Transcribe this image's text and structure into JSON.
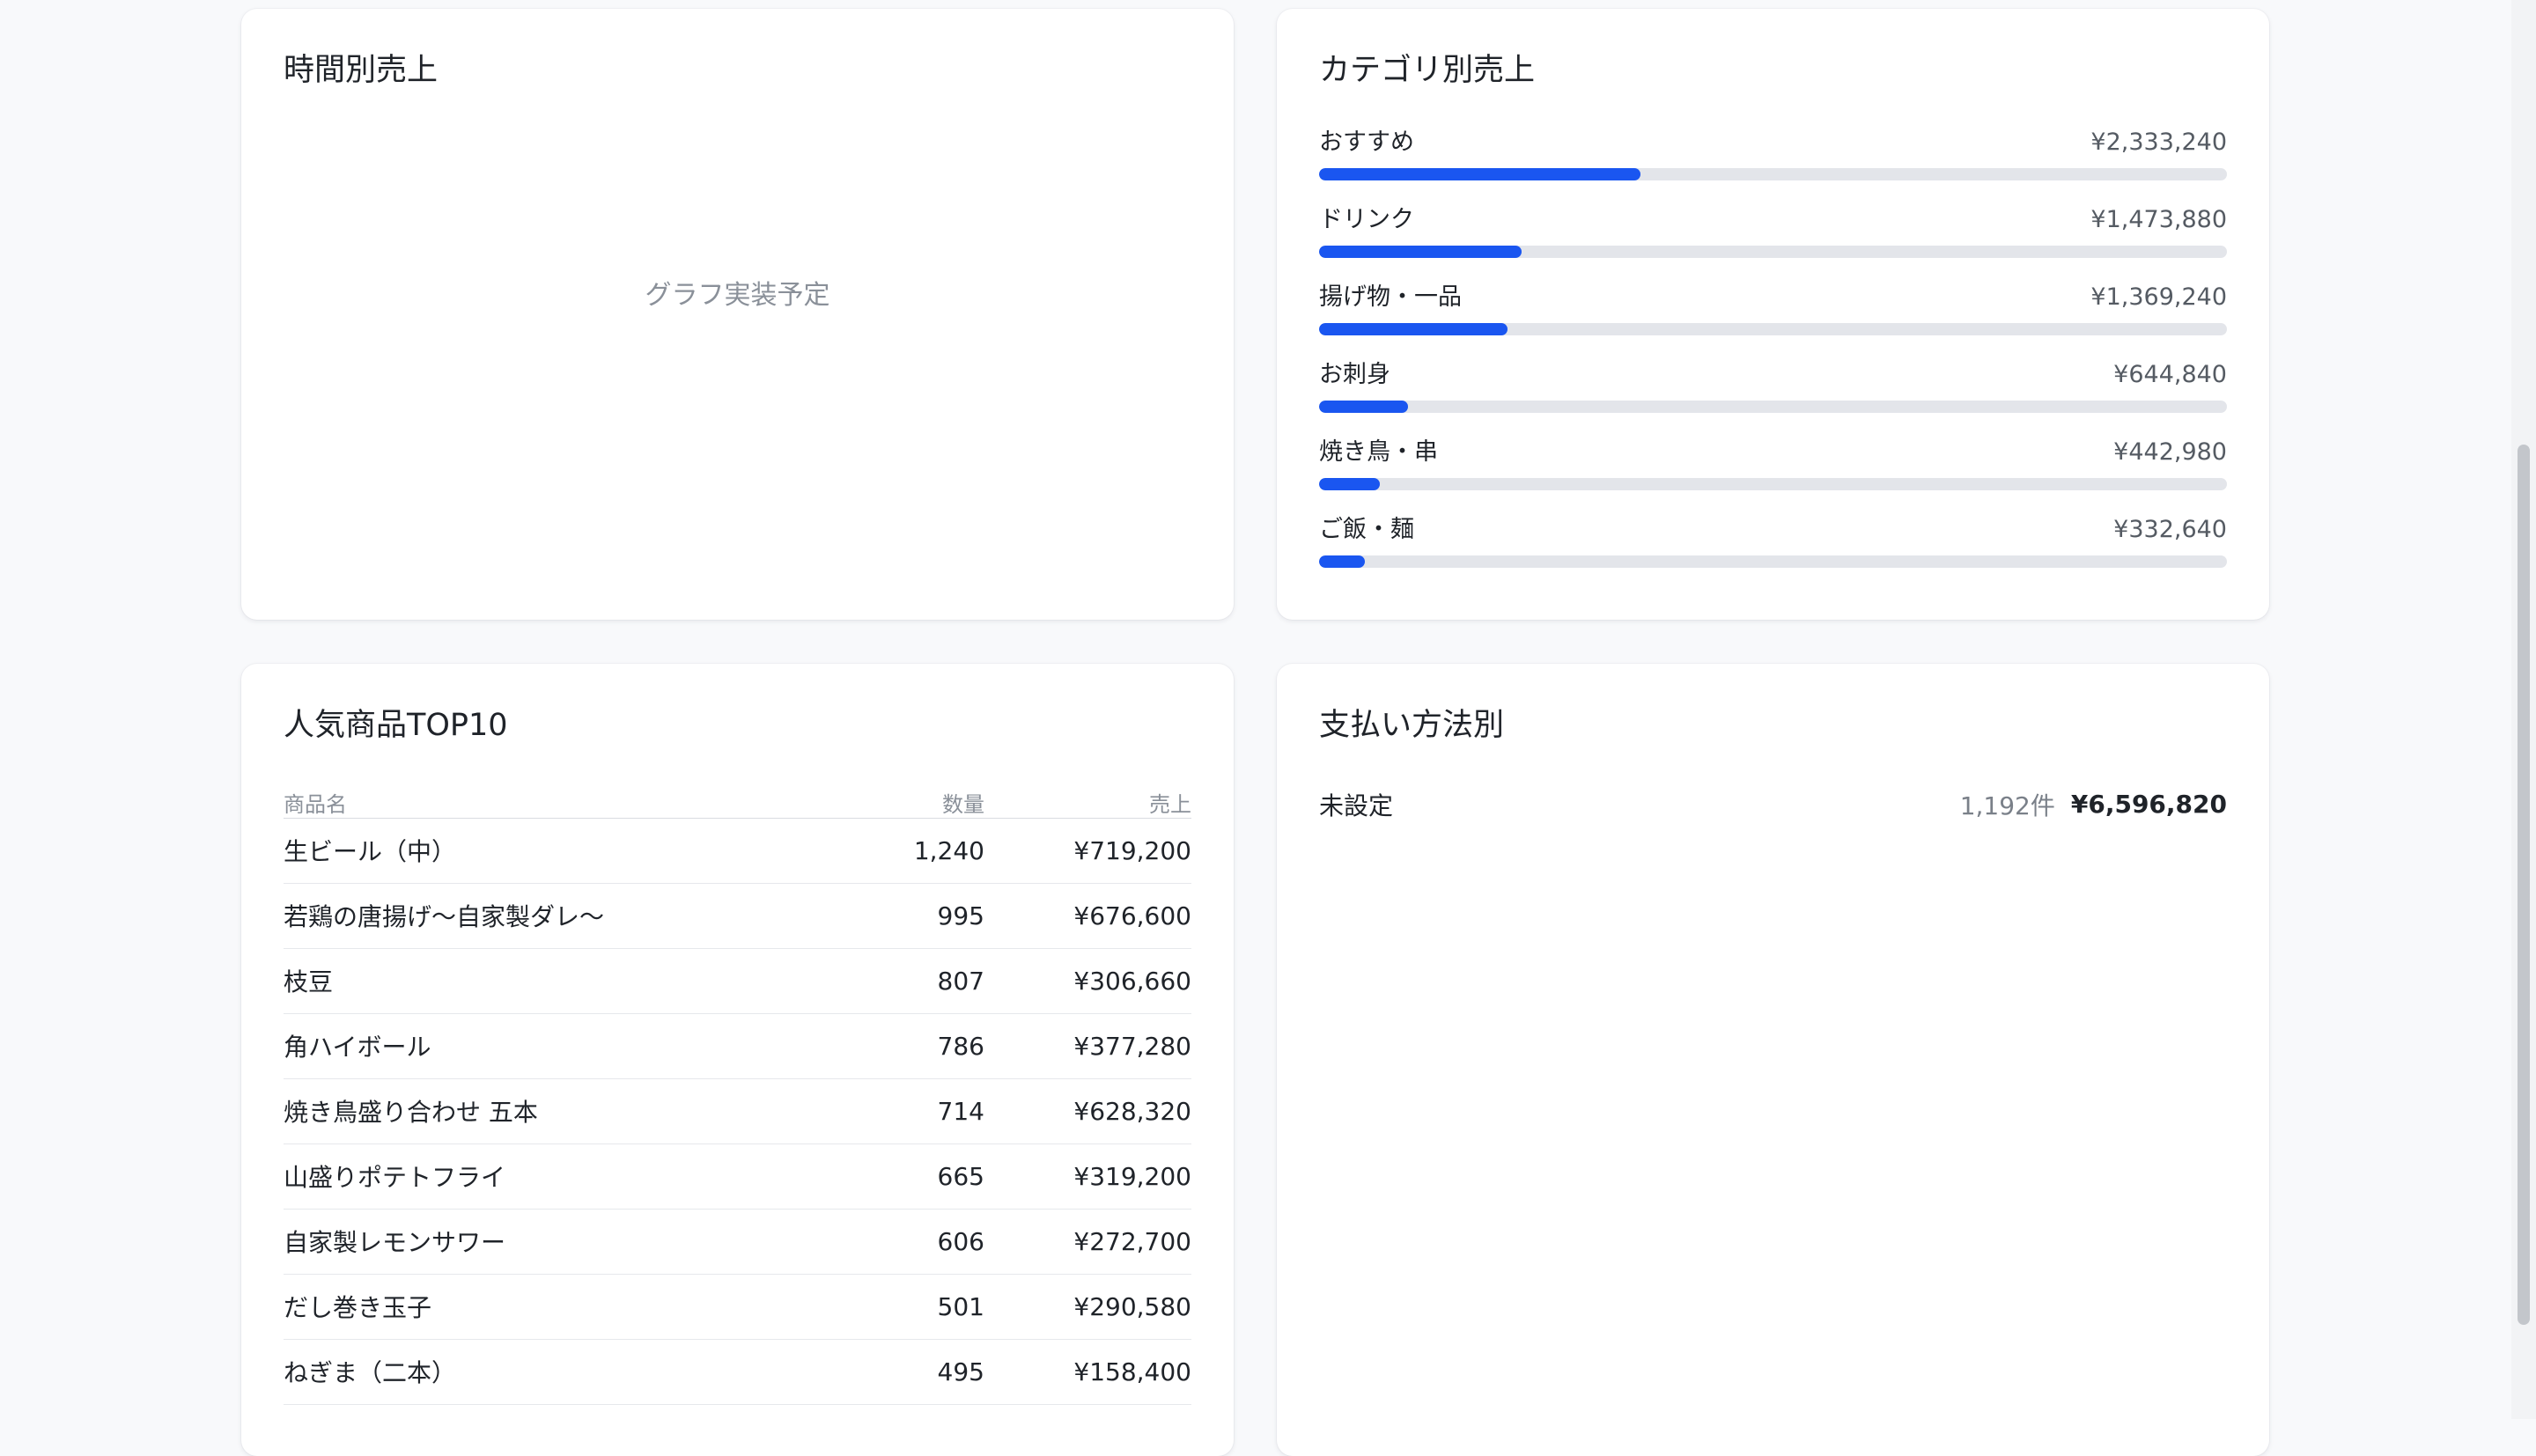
{
  "hourly": {
    "title": "時間別売上",
    "placeholder": "グラフ実装予定"
  },
  "category": {
    "title": "カテゴリ別売上",
    "accent_color": "#1a56f0",
    "items": [
      {
        "name": "おすすめ",
        "amount": "¥2,333,240",
        "share": 0.354
      },
      {
        "name": "ドリンク",
        "amount": "¥1,473,880",
        "share": 0.223
      },
      {
        "name": "揚げ物・一品",
        "amount": "¥1,369,240",
        "share": 0.208
      },
      {
        "name": "お刺身",
        "amount": "¥644,840",
        "share": 0.098
      },
      {
        "name": "焼き鳥・串",
        "amount": "¥442,980",
        "share": 0.067
      },
      {
        "name": "ご飯・麺",
        "amount": "¥332,640",
        "share": 0.05
      }
    ]
  },
  "top10": {
    "title": "人気商品TOP10",
    "headers": {
      "name": "商品名",
      "qty": "数量",
      "sales": "売上"
    },
    "rows": [
      {
        "name": "生ビール（中）",
        "qty": "1,240",
        "sales": "¥719,200"
      },
      {
        "name": "若鶏の唐揚げ〜自家製ダレ〜",
        "qty": "995",
        "sales": "¥676,600"
      },
      {
        "name": "枝豆",
        "qty": "807",
        "sales": "¥306,660"
      },
      {
        "name": "角ハイボール",
        "qty": "786",
        "sales": "¥377,280"
      },
      {
        "name": "焼き鳥盛り合わせ 五本",
        "qty": "714",
        "sales": "¥628,320"
      },
      {
        "name": "山盛りポテトフライ",
        "qty": "665",
        "sales": "¥319,200"
      },
      {
        "name": "自家製レモンサワー",
        "qty": "606",
        "sales": "¥272,700"
      },
      {
        "name": "だし巻き玉子",
        "qty": "501",
        "sales": "¥290,580"
      },
      {
        "name": "ねぎま（二本）",
        "qty": "495",
        "sales": "¥158,400"
      }
    ]
  },
  "payment": {
    "title": "支払い方法別",
    "rows": [
      {
        "method": "未設定",
        "count": "1,192件",
        "amount": "¥6,596,820"
      }
    ]
  }
}
